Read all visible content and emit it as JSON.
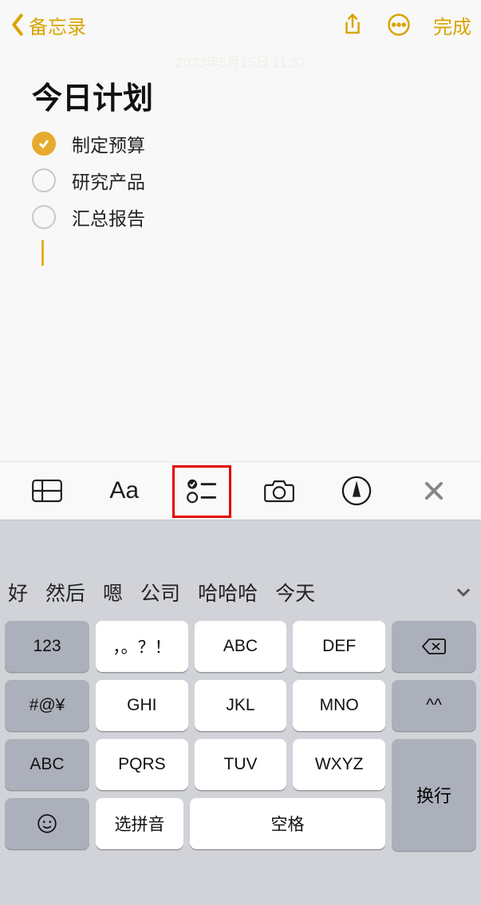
{
  "nav": {
    "back_label": "备忘录",
    "done_label": "完成"
  },
  "note": {
    "date": "2023年5月15日 11:32",
    "title": "今日计划",
    "items": [
      {
        "checked": true,
        "text": "制定预算"
      },
      {
        "checked": false,
        "text": "研究产品"
      },
      {
        "checked": false,
        "text": "汇总报告"
      }
    ]
  },
  "toolbar": {
    "format_label": "Aa"
  },
  "keyboard": {
    "suggestions": [
      "好",
      "然后",
      "嗯",
      "公司",
      "哈哈哈",
      "今天"
    ],
    "keys": {
      "r1": [
        "123",
        "，。？！",
        "ABC",
        "DEF"
      ],
      "r2": [
        "#@¥",
        "GHI",
        "JKL",
        "MNO",
        "^^"
      ],
      "r3": [
        "ABC",
        "PQRS",
        "TUV",
        "WXYZ"
      ],
      "r4_pinyin": "选拼音",
      "r4_space": "空格",
      "enter": "换行"
    }
  }
}
